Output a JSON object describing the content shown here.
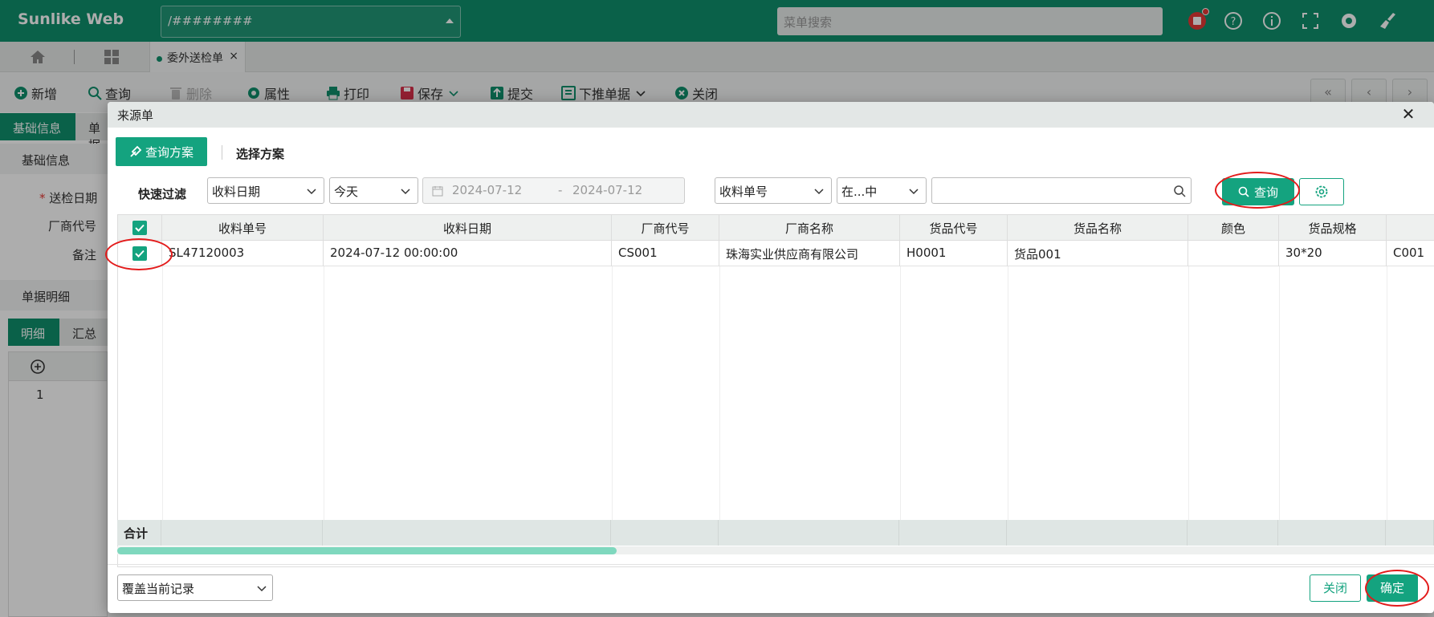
{
  "topbar": {
    "brand": "Sunlike Web",
    "route_value": "/########",
    "menu_search_placeholder": "菜单搜索"
  },
  "tabs": {
    "doc_tab_label": "委外送检单",
    "doc_tab_close": "×"
  },
  "toolbar": {
    "new": "新增",
    "query": "查询",
    "delete": "删除",
    "properties": "属性",
    "print": "打印",
    "save": "保存",
    "submit": "提交",
    "push_down": "下推单据",
    "close": "关闭",
    "pager": [
      "«",
      "‹",
      "›"
    ]
  },
  "background_page": {
    "tab_basic": "基础信息",
    "tab_doc": "单据",
    "section_basic": "基础信息",
    "field_inspect_date": "送检日期",
    "required_mark": "*",
    "field_vendor_code": "厂商代号",
    "field_remark": "备注",
    "section_detail": "单据明细",
    "tab_detail": "明细",
    "tab_summary": "汇总",
    "row_number": "1"
  },
  "dialog": {
    "title": "来源单",
    "close_glyph": "✕",
    "scheme_button": "查询方案",
    "choose_scheme": "选择方案",
    "quick_filter_label": "快速过滤",
    "filter_field": "收料日期",
    "filter_period": "今天",
    "date_from": "2024-07-12",
    "date_sep": "-",
    "date_to": "2024-07-12",
    "search_field": "收料单号",
    "search_operator": "在...中",
    "search_value": "",
    "query_button": "查询",
    "columns": [
      "收料单号",
      "收料日期",
      "厂商代号",
      "厂商名称",
      "货品代号",
      "货品名称",
      "颜色",
      "货品规格",
      ""
    ],
    "rows": [
      {
        "checked": true,
        "cells": [
          "SL47120003",
          "2024-07-12 00:00:00",
          "CS001",
          "珠海实业供应商有限公司",
          "H0001",
          "货品001",
          "",
          "30*20",
          "C001"
        ]
      }
    ],
    "summary_label": "合计",
    "mode_select": "覆盖当前记录",
    "close_button": "关闭",
    "ok_button": "确定"
  },
  "colors": {
    "brand_green": "#0f8f6c",
    "button_green": "#14a37f",
    "annotation_red": "#e31b1b"
  },
  "icons": [
    "home-icon",
    "grid-icon",
    "plus-circle-icon",
    "search-icon",
    "trash-icon",
    "gear-icon",
    "printer-icon",
    "save-icon",
    "upload-icon",
    "push-down-icon",
    "close-circle-icon",
    "calendar-icon",
    "chevron-down-icon",
    "help-icon",
    "info-icon",
    "fullscreen-icon",
    "broom-icon",
    "notification-icon"
  ]
}
